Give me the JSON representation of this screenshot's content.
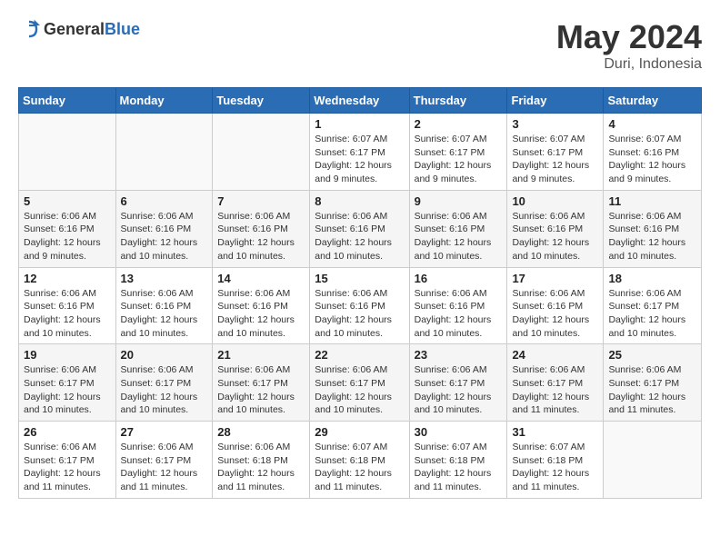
{
  "header": {
    "logo_general": "General",
    "logo_blue": "Blue",
    "month_year": "May 2024",
    "location": "Duri, Indonesia"
  },
  "weekdays": [
    "Sunday",
    "Monday",
    "Tuesday",
    "Wednesday",
    "Thursday",
    "Friday",
    "Saturday"
  ],
  "weeks": [
    [
      {
        "day": "",
        "info": ""
      },
      {
        "day": "",
        "info": ""
      },
      {
        "day": "",
        "info": ""
      },
      {
        "day": "1",
        "info": "Sunrise: 6:07 AM\nSunset: 6:17 PM\nDaylight: 12 hours and 9 minutes."
      },
      {
        "day": "2",
        "info": "Sunrise: 6:07 AM\nSunset: 6:17 PM\nDaylight: 12 hours and 9 minutes."
      },
      {
        "day": "3",
        "info": "Sunrise: 6:07 AM\nSunset: 6:17 PM\nDaylight: 12 hours and 9 minutes."
      },
      {
        "day": "4",
        "info": "Sunrise: 6:07 AM\nSunset: 6:16 PM\nDaylight: 12 hours and 9 minutes."
      }
    ],
    [
      {
        "day": "5",
        "info": "Sunrise: 6:06 AM\nSunset: 6:16 PM\nDaylight: 12 hours and 9 minutes."
      },
      {
        "day": "6",
        "info": "Sunrise: 6:06 AM\nSunset: 6:16 PM\nDaylight: 12 hours and 10 minutes."
      },
      {
        "day": "7",
        "info": "Sunrise: 6:06 AM\nSunset: 6:16 PM\nDaylight: 12 hours and 10 minutes."
      },
      {
        "day": "8",
        "info": "Sunrise: 6:06 AM\nSunset: 6:16 PM\nDaylight: 12 hours and 10 minutes."
      },
      {
        "day": "9",
        "info": "Sunrise: 6:06 AM\nSunset: 6:16 PM\nDaylight: 12 hours and 10 minutes."
      },
      {
        "day": "10",
        "info": "Sunrise: 6:06 AM\nSunset: 6:16 PM\nDaylight: 12 hours and 10 minutes."
      },
      {
        "day": "11",
        "info": "Sunrise: 6:06 AM\nSunset: 6:16 PM\nDaylight: 12 hours and 10 minutes."
      }
    ],
    [
      {
        "day": "12",
        "info": "Sunrise: 6:06 AM\nSunset: 6:16 PM\nDaylight: 12 hours and 10 minutes."
      },
      {
        "day": "13",
        "info": "Sunrise: 6:06 AM\nSunset: 6:16 PM\nDaylight: 12 hours and 10 minutes."
      },
      {
        "day": "14",
        "info": "Sunrise: 6:06 AM\nSunset: 6:16 PM\nDaylight: 12 hours and 10 minutes."
      },
      {
        "day": "15",
        "info": "Sunrise: 6:06 AM\nSunset: 6:16 PM\nDaylight: 12 hours and 10 minutes."
      },
      {
        "day": "16",
        "info": "Sunrise: 6:06 AM\nSunset: 6:16 PM\nDaylight: 12 hours and 10 minutes."
      },
      {
        "day": "17",
        "info": "Sunrise: 6:06 AM\nSunset: 6:16 PM\nDaylight: 12 hours and 10 minutes."
      },
      {
        "day": "18",
        "info": "Sunrise: 6:06 AM\nSunset: 6:17 PM\nDaylight: 12 hours and 10 minutes."
      }
    ],
    [
      {
        "day": "19",
        "info": "Sunrise: 6:06 AM\nSunset: 6:17 PM\nDaylight: 12 hours and 10 minutes."
      },
      {
        "day": "20",
        "info": "Sunrise: 6:06 AM\nSunset: 6:17 PM\nDaylight: 12 hours and 10 minutes."
      },
      {
        "day": "21",
        "info": "Sunrise: 6:06 AM\nSunset: 6:17 PM\nDaylight: 12 hours and 10 minutes."
      },
      {
        "day": "22",
        "info": "Sunrise: 6:06 AM\nSunset: 6:17 PM\nDaylight: 12 hours and 10 minutes."
      },
      {
        "day": "23",
        "info": "Sunrise: 6:06 AM\nSunset: 6:17 PM\nDaylight: 12 hours and 10 minutes."
      },
      {
        "day": "24",
        "info": "Sunrise: 6:06 AM\nSunset: 6:17 PM\nDaylight: 12 hours and 11 minutes."
      },
      {
        "day": "25",
        "info": "Sunrise: 6:06 AM\nSunset: 6:17 PM\nDaylight: 12 hours and 11 minutes."
      }
    ],
    [
      {
        "day": "26",
        "info": "Sunrise: 6:06 AM\nSunset: 6:17 PM\nDaylight: 12 hours and 11 minutes."
      },
      {
        "day": "27",
        "info": "Sunrise: 6:06 AM\nSunset: 6:17 PM\nDaylight: 12 hours and 11 minutes."
      },
      {
        "day": "28",
        "info": "Sunrise: 6:06 AM\nSunset: 6:18 PM\nDaylight: 12 hours and 11 minutes."
      },
      {
        "day": "29",
        "info": "Sunrise: 6:07 AM\nSunset: 6:18 PM\nDaylight: 12 hours and 11 minutes."
      },
      {
        "day": "30",
        "info": "Sunrise: 6:07 AM\nSunset: 6:18 PM\nDaylight: 12 hours and 11 minutes."
      },
      {
        "day": "31",
        "info": "Sunrise: 6:07 AM\nSunset: 6:18 PM\nDaylight: 12 hours and 11 minutes."
      },
      {
        "day": "",
        "info": ""
      }
    ]
  ]
}
